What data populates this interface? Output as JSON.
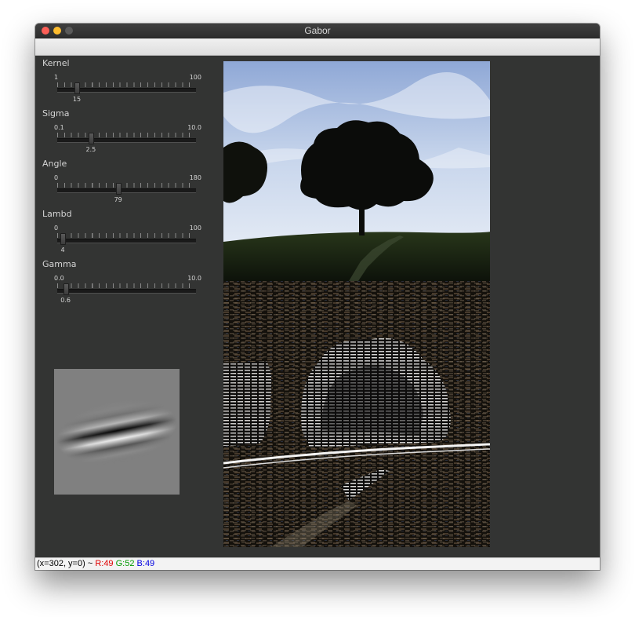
{
  "window": {
    "title": "Gabor"
  },
  "trackbars": [
    {
      "name": "Kernel",
      "min": "1",
      "max": "100",
      "value": "15",
      "fraction": 0.141
    },
    {
      "name": "Sigma",
      "min": "0.1",
      "max": "10.0",
      "value": "2.5",
      "fraction": 0.242
    },
    {
      "name": "Angle",
      "min": "0",
      "max": "180",
      "value": "79",
      "fraction": 0.439
    },
    {
      "name": "Lambd",
      "min": "0",
      "max": "100",
      "value": "4",
      "fraction": 0.04
    },
    {
      "name": "Gamma",
      "min": "0.0",
      "max": "10.0",
      "value": "0.6",
      "fraction": 0.06
    }
  ],
  "status": {
    "coords": "(x=302, y=0) ~",
    "r": "R:49",
    "g": "G:52",
    "b": "B:49"
  },
  "colors": {
    "status_r": "#e00000",
    "status_g": "#009a00",
    "status_b": "#0000e0",
    "background": "#333433"
  }
}
